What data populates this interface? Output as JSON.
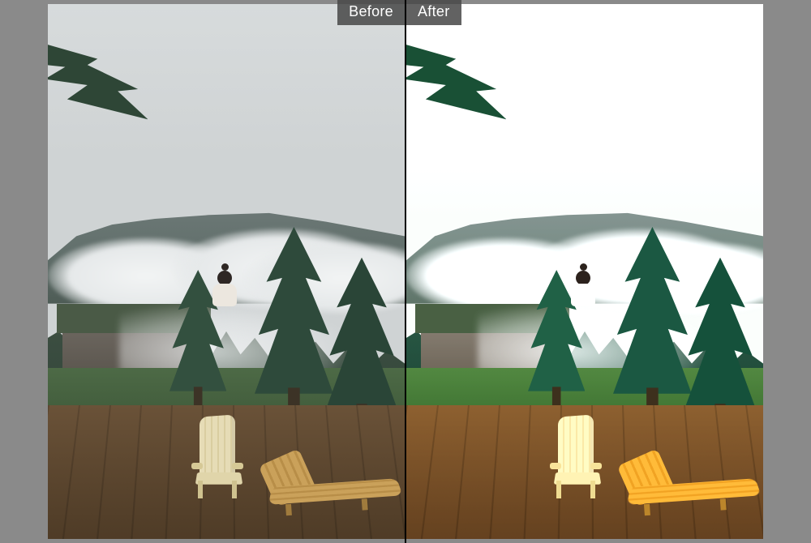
{
  "labels": {
    "before": "Before",
    "after": "After"
  },
  "panels": {
    "left": {
      "role": "original-photo"
    },
    "right": {
      "role": "edited-photo"
    }
  }
}
